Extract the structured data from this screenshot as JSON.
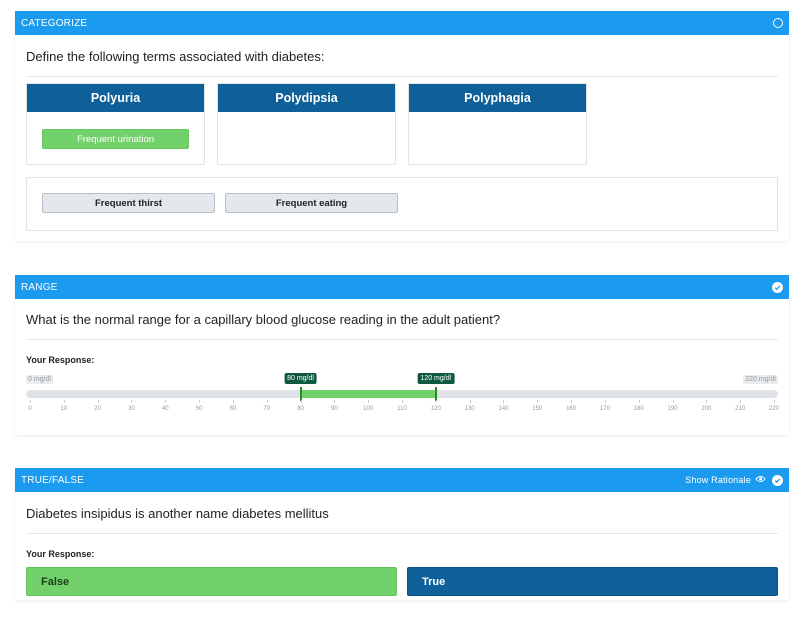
{
  "categorize": {
    "header": "CATEGORIZE",
    "question": "Define the following terms associated with diabetes:",
    "categories": [
      {
        "title": "Polyuria",
        "items": [
          "Frequent urination"
        ]
      },
      {
        "title": "Polydipsia",
        "items": []
      },
      {
        "title": "Polyphagia",
        "items": []
      }
    ],
    "pool": [
      "Frequent thirst",
      "Frequent eating"
    ]
  },
  "range": {
    "header": "RANGE",
    "question": "What is the normal range for a capillary blood glucose reading in the adult patient?",
    "response_label": "Your Response:",
    "min_label": "0 mg/dl",
    "max_label": "220 mg/dl",
    "low_label": "80 mg/dl",
    "high_label": "120 mg/dl",
    "min": 0,
    "max": 220,
    "low": 80,
    "high": 120,
    "ticks": [
      "0",
      "10",
      "20",
      "30",
      "40",
      "50",
      "60",
      "70",
      "80",
      "90",
      "100",
      "110",
      "120",
      "130",
      "140",
      "150",
      "160",
      "170",
      "180",
      "190",
      "200",
      "210",
      "220"
    ]
  },
  "truefalse": {
    "header": "TRUE/FALSE",
    "show_rationale": "Show Rationale",
    "question": "Diabetes insipidus is another name diabetes mellitus",
    "response_label": "Your Response:",
    "false_label": "False",
    "true_label": "True"
  },
  "colors": {
    "header_blue": "#1a9bf0",
    "dark_blue": "#0f5f99",
    "green": "#72d16a"
  }
}
